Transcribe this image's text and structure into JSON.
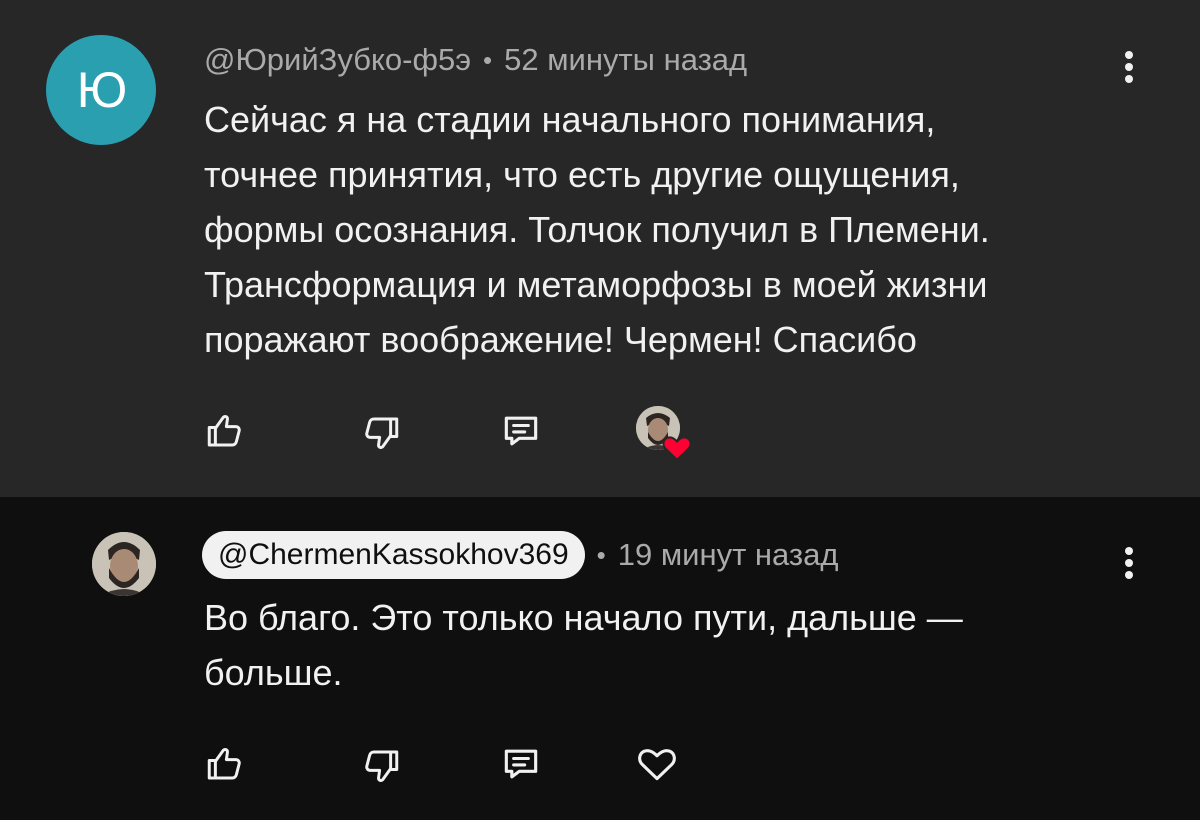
{
  "comments": [
    {
      "avatar_letter": "Ю",
      "author": "@ЮрийЗубко-ф5э",
      "separator": "•",
      "time": "52 минуты назад",
      "text": "Сейчас я на стадии начального понимания,\nточнее принятия, что есть другие ощущения,\nформы осознания. Толчок получил в Племени.\nТрансформация и метаморфозы в моей жизни\nпоражают воображение! Чермен! Спасибо",
      "actions": [
        "like-icon",
        "dislike-icon",
        "reply-icon",
        "creator-heart-icon"
      ]
    },
    {
      "author": "@ChermenKassokhov369",
      "separator": "•",
      "time": "19 минут назад",
      "text": "Во благо. Это только начало пути, дальше —\nбольше.",
      "actions": [
        "like-icon",
        "dislike-icon",
        "reply-icon",
        "heart-icon"
      ]
    }
  ],
  "colors": {
    "comment_bg_highlight": "#272727",
    "page_bg": "#0f0f0f",
    "avatar_teal": "#2a9fb0",
    "heart_red": "#ff0033"
  }
}
